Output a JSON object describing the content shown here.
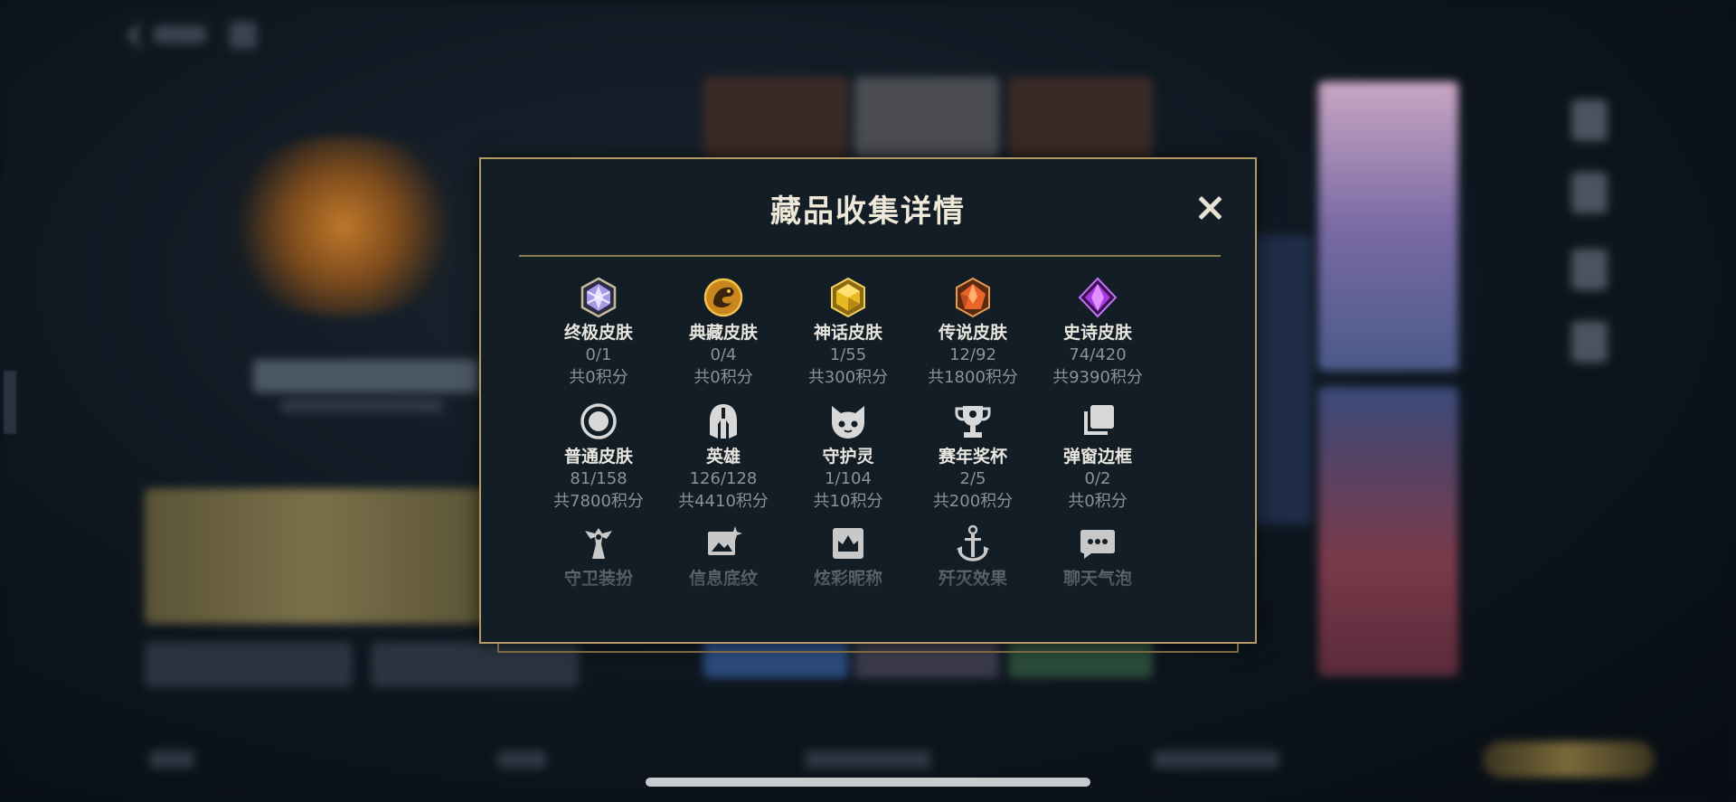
{
  "modal": {
    "title": "藏品收集详情",
    "close_label": "close"
  },
  "collections": [
    {
      "label": "终极皮肤",
      "count": "0/1",
      "points": "共0积分",
      "icon": "ultimate-skin-gem-icon",
      "color": "#b8a8f0"
    },
    {
      "label": "典藏皮肤",
      "count": "0/4",
      "points": "共0积分",
      "icon": "prestige-skin-dragon-icon",
      "color": "#d9a030"
    },
    {
      "label": "神话皮肤",
      "count": "1/55",
      "points": "共300积分",
      "icon": "mythic-skin-gem-icon",
      "color": "#e8c030"
    },
    {
      "label": "传说皮肤",
      "count": "12/92",
      "points": "共1800积分",
      "icon": "legendary-skin-gem-icon",
      "color": "#e86a2a"
    },
    {
      "label": "史诗皮肤",
      "count": "74/420",
      "points": "共9390积分",
      "icon": "epic-skin-gem-icon",
      "color": "#b040e0"
    },
    {
      "label": "普通皮肤",
      "count": "81/158",
      "points": "共7800积分",
      "icon": "normal-skin-circle-icon",
      "color": "#d8d8d8"
    },
    {
      "label": "英雄",
      "count": "126/128",
      "points": "共4410积分",
      "icon": "champion-helmet-icon",
      "color": "#d8d8d8"
    },
    {
      "label": "守护灵",
      "count": "1/104",
      "points": "共10积分",
      "icon": "guardian-pet-icon",
      "color": "#d8d8d8"
    },
    {
      "label": "赛年奖杯",
      "count": "2/5",
      "points": "共200积分",
      "icon": "season-trophy-icon",
      "color": "#d8d8d8"
    },
    {
      "label": "弹窗边框",
      "count": "0/2",
      "points": "共0积分",
      "icon": "popup-frame-icon",
      "color": "#d8d8d8"
    },
    {
      "label": "守卫装扮",
      "icon": "ward-skin-icon",
      "color": "#c8c8c8"
    },
    {
      "label": "信息底纹",
      "icon": "info-background-icon",
      "color": "#c8c8c8"
    },
    {
      "label": "炫彩昵称",
      "icon": "colorful-nickname-icon",
      "color": "#c8c8c8"
    },
    {
      "label": "歼灭效果",
      "icon": "elimination-effect-icon",
      "color": "#c8c8c8"
    },
    {
      "label": "聊天气泡",
      "icon": "chat-bubble-icon",
      "color": "#c8c8c8"
    }
  ],
  "colors": {
    "panel_bg": "#121d26",
    "gold_border": "#b49a62",
    "title_text": "#eee8d8"
  }
}
